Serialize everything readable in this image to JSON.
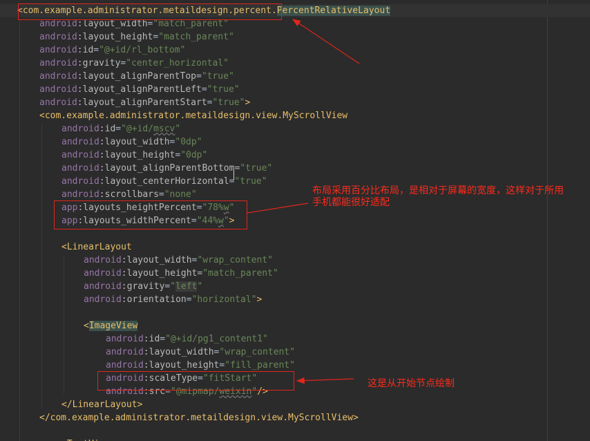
{
  "editor": {
    "lines": [
      {
        "indent": 0,
        "tokens": [
          {
            "t": "<com.example.administrator.metaildesign.percent.",
            "c": "tag"
          },
          {
            "t": "PercentRelativeLayout",
            "c": "hl-tag"
          }
        ],
        "current": true
      },
      {
        "indent": 1,
        "tokens": [
          {
            "t": "android",
            "c": "ns"
          },
          {
            "t": ":layout_width",
            "c": "attr"
          },
          {
            "t": "=",
            "c": "eq"
          },
          {
            "t": "\"match_parent\"",
            "c": "val"
          }
        ]
      },
      {
        "indent": 1,
        "tokens": [
          {
            "t": "android",
            "c": "ns"
          },
          {
            "t": ":layout_height",
            "c": "attr"
          },
          {
            "t": "=",
            "c": "eq"
          },
          {
            "t": "\"match_parent\"",
            "c": "val"
          }
        ]
      },
      {
        "indent": 1,
        "tokens": [
          {
            "t": "android",
            "c": "ns"
          },
          {
            "t": ":id",
            "c": "attr"
          },
          {
            "t": "=",
            "c": "eq"
          },
          {
            "t": "\"@+id/rl_bottom\"",
            "c": "val"
          }
        ]
      },
      {
        "indent": 1,
        "tokens": [
          {
            "t": "android",
            "c": "ns"
          },
          {
            "t": ":gravity",
            "c": "attr"
          },
          {
            "t": "=",
            "c": "eq"
          },
          {
            "t": "\"center_horizontal\"",
            "c": "val"
          }
        ]
      },
      {
        "indent": 1,
        "tokens": [
          {
            "t": "android",
            "c": "ns"
          },
          {
            "t": ":layout_alignParentTop",
            "c": "attr"
          },
          {
            "t": "=",
            "c": "eq"
          },
          {
            "t": "\"true\"",
            "c": "val"
          }
        ]
      },
      {
        "indent": 1,
        "tokens": [
          {
            "t": "android",
            "c": "ns"
          },
          {
            "t": ":layout_alignParentLeft",
            "c": "attr"
          },
          {
            "t": "=",
            "c": "eq"
          },
          {
            "t": "\"true\"",
            "c": "val"
          }
        ]
      },
      {
        "indent": 1,
        "tokens": [
          {
            "t": "android",
            "c": "ns"
          },
          {
            "t": ":layout_alignParentStart",
            "c": "attr"
          },
          {
            "t": "=",
            "c": "eq"
          },
          {
            "t": "\"true\"",
            "c": "val"
          },
          {
            "t": ">",
            "c": "punct"
          }
        ]
      },
      {
        "indent": 1,
        "tokens": [
          {
            "t": "<com.example.administrator.metaildesign.view.MyScrollView",
            "c": "tag"
          }
        ]
      },
      {
        "indent": 2,
        "tokens": [
          {
            "t": "android",
            "c": "ns"
          },
          {
            "t": ":id",
            "c": "attr"
          },
          {
            "t": "=",
            "c": "eq"
          },
          {
            "t": "\"@+id/",
            "c": "val"
          },
          {
            "t": "mscv",
            "c": "val-wavy"
          },
          {
            "t": "\"",
            "c": "val"
          }
        ]
      },
      {
        "indent": 2,
        "tokens": [
          {
            "t": "android",
            "c": "ns"
          },
          {
            "t": ":layout_width",
            "c": "attr"
          },
          {
            "t": "=",
            "c": "eq"
          },
          {
            "t": "\"0dp\"",
            "c": "val"
          }
        ]
      },
      {
        "indent": 2,
        "tokens": [
          {
            "t": "android",
            "c": "ns"
          },
          {
            "t": ":layout_height",
            "c": "attr"
          },
          {
            "t": "=",
            "c": "eq"
          },
          {
            "t": "\"0dp\"",
            "c": "val"
          }
        ]
      },
      {
        "indent": 2,
        "tokens": [
          {
            "t": "android",
            "c": "ns"
          },
          {
            "t": ":layout_alignParentBottom",
            "c": "attr"
          },
          {
            "t": "=",
            "c": "eq"
          },
          {
            "t": "\"true\"",
            "c": "val"
          }
        ]
      },
      {
        "indent": 2,
        "tokens": [
          {
            "t": "android",
            "c": "ns"
          },
          {
            "t": ":layout_centerHorizontal",
            "c": "attr"
          },
          {
            "t": "=",
            "c": "eq"
          },
          {
            "t": "\"true\"",
            "c": "val"
          }
        ]
      },
      {
        "indent": 2,
        "tokens": [
          {
            "t": "android",
            "c": "ns"
          },
          {
            "t": ":scrollbars",
            "c": "attr"
          },
          {
            "t": "=",
            "c": "eq"
          },
          {
            "t": "\"none\"",
            "c": "val"
          }
        ]
      },
      {
        "indent": 2,
        "tokens": [
          {
            "t": "app",
            "c": "ns"
          },
          {
            "t": ":layouts_heightPercent",
            "c": "attr"
          },
          {
            "t": "=",
            "c": "eq"
          },
          {
            "t": "\"78%",
            "c": "val"
          },
          {
            "t": "w",
            "c": "val-wavy"
          },
          {
            "t": "\"",
            "c": "val"
          }
        ]
      },
      {
        "indent": 2,
        "tokens": [
          {
            "t": "app",
            "c": "ns"
          },
          {
            "t": ":layouts_widthPercent",
            "c": "attr"
          },
          {
            "t": "=",
            "c": "eq"
          },
          {
            "t": "\"44%",
            "c": "val"
          },
          {
            "t": "w",
            "c": "val-wavy"
          },
          {
            "t": "\"",
            "c": "val"
          },
          {
            "t": ">",
            "c": "punct"
          }
        ]
      },
      {
        "indent": 0,
        "tokens": []
      },
      {
        "indent": 2,
        "tokens": [
          {
            "t": "<LinearLayout",
            "c": "tag"
          }
        ]
      },
      {
        "indent": 3,
        "tokens": [
          {
            "t": "android",
            "c": "ns"
          },
          {
            "t": ":layout_width",
            "c": "attr"
          },
          {
            "t": "=",
            "c": "eq"
          },
          {
            "t": "\"wrap_content\"",
            "c": "val"
          }
        ]
      },
      {
        "indent": 3,
        "tokens": [
          {
            "t": "android",
            "c": "ns"
          },
          {
            "t": ":layout_height",
            "c": "attr"
          },
          {
            "t": "=",
            "c": "eq"
          },
          {
            "t": "\"match_parent\"",
            "c": "val"
          }
        ]
      },
      {
        "indent": 3,
        "tokens": [
          {
            "t": "android",
            "c": "ns"
          },
          {
            "t": ":gravity",
            "c": "attr"
          },
          {
            "t": "=",
            "c": "eq"
          },
          {
            "t": "\"",
            "c": "val"
          },
          {
            "t": "left",
            "c": "val-hl"
          },
          {
            "t": "\"",
            "c": "val"
          }
        ]
      },
      {
        "indent": 3,
        "tokens": [
          {
            "t": "android",
            "c": "ns"
          },
          {
            "t": ":orientation",
            "c": "attr"
          },
          {
            "t": "=",
            "c": "eq"
          },
          {
            "t": "\"horizontal\"",
            "c": "val"
          },
          {
            "t": ">",
            "c": "punct"
          }
        ]
      },
      {
        "indent": 0,
        "tokens": []
      },
      {
        "indent": 3,
        "tokens": [
          {
            "t": "<",
            "c": "tag"
          },
          {
            "t": "ImageView",
            "c": "hl-tag"
          }
        ]
      },
      {
        "indent": 4,
        "tokens": [
          {
            "t": "android",
            "c": "ns"
          },
          {
            "t": ":id",
            "c": "attr"
          },
          {
            "t": "=",
            "c": "eq"
          },
          {
            "t": "\"@+id/pg1_content1\"",
            "c": "val"
          }
        ]
      },
      {
        "indent": 4,
        "tokens": [
          {
            "t": "android",
            "c": "ns"
          },
          {
            "t": ":layout_width",
            "c": "attr"
          },
          {
            "t": "=",
            "c": "eq"
          },
          {
            "t": "\"wrap_content\"",
            "c": "val"
          }
        ]
      },
      {
        "indent": 4,
        "tokens": [
          {
            "t": "android",
            "c": "ns"
          },
          {
            "t": ":layout_height",
            "c": "attr"
          },
          {
            "t": "=",
            "c": "eq"
          },
          {
            "t": "\"fill_parent\"",
            "c": "val"
          }
        ]
      },
      {
        "indent": 4,
        "tokens": [
          {
            "t": "android",
            "c": "ns"
          },
          {
            "t": ":scaleType",
            "c": "attr"
          },
          {
            "t": "=",
            "c": "eq"
          },
          {
            "t": "\"fitStart\"",
            "c": "val"
          }
        ]
      },
      {
        "indent": 4,
        "tokens": [
          {
            "t": "android",
            "c": "ns"
          },
          {
            "t": ":src",
            "c": "attr"
          },
          {
            "t": "=",
            "c": "eq"
          },
          {
            "t": "\"@mipmap/",
            "c": "val"
          },
          {
            "t": "weixin",
            "c": "val-wavy"
          },
          {
            "t": "\"",
            "c": "val"
          },
          {
            "t": "/>",
            "c": "punct"
          }
        ]
      },
      {
        "indent": 2,
        "tokens": [
          {
            "t": "</LinearLayout>",
            "c": "tag"
          }
        ]
      },
      {
        "indent": 1,
        "tokens": [
          {
            "t": "</com.example.administrator.metaildesign.view.MyScrollView>",
            "c": "tag"
          }
        ]
      },
      {
        "indent": 0,
        "tokens": []
      },
      {
        "indent": 2,
        "tokens": [
          {
            "t": "<TextView",
            "c": "tag"
          }
        ]
      }
    ]
  },
  "annotations": {
    "percent_note_line1": "布局采用百分比布局，是相对于屏幕的宽度，这样对于所用",
    "percent_note_line2": "手机都能很好适配",
    "scaletype_note": "这是从开始节点绘制"
  },
  "colors": {
    "background": "#2b2b2b",
    "tag": "#e8bf6a",
    "namespace": "#9876aa",
    "attribute": "#bababa",
    "value": "#6a8759",
    "annotation_red": "#ff2a1c"
  }
}
